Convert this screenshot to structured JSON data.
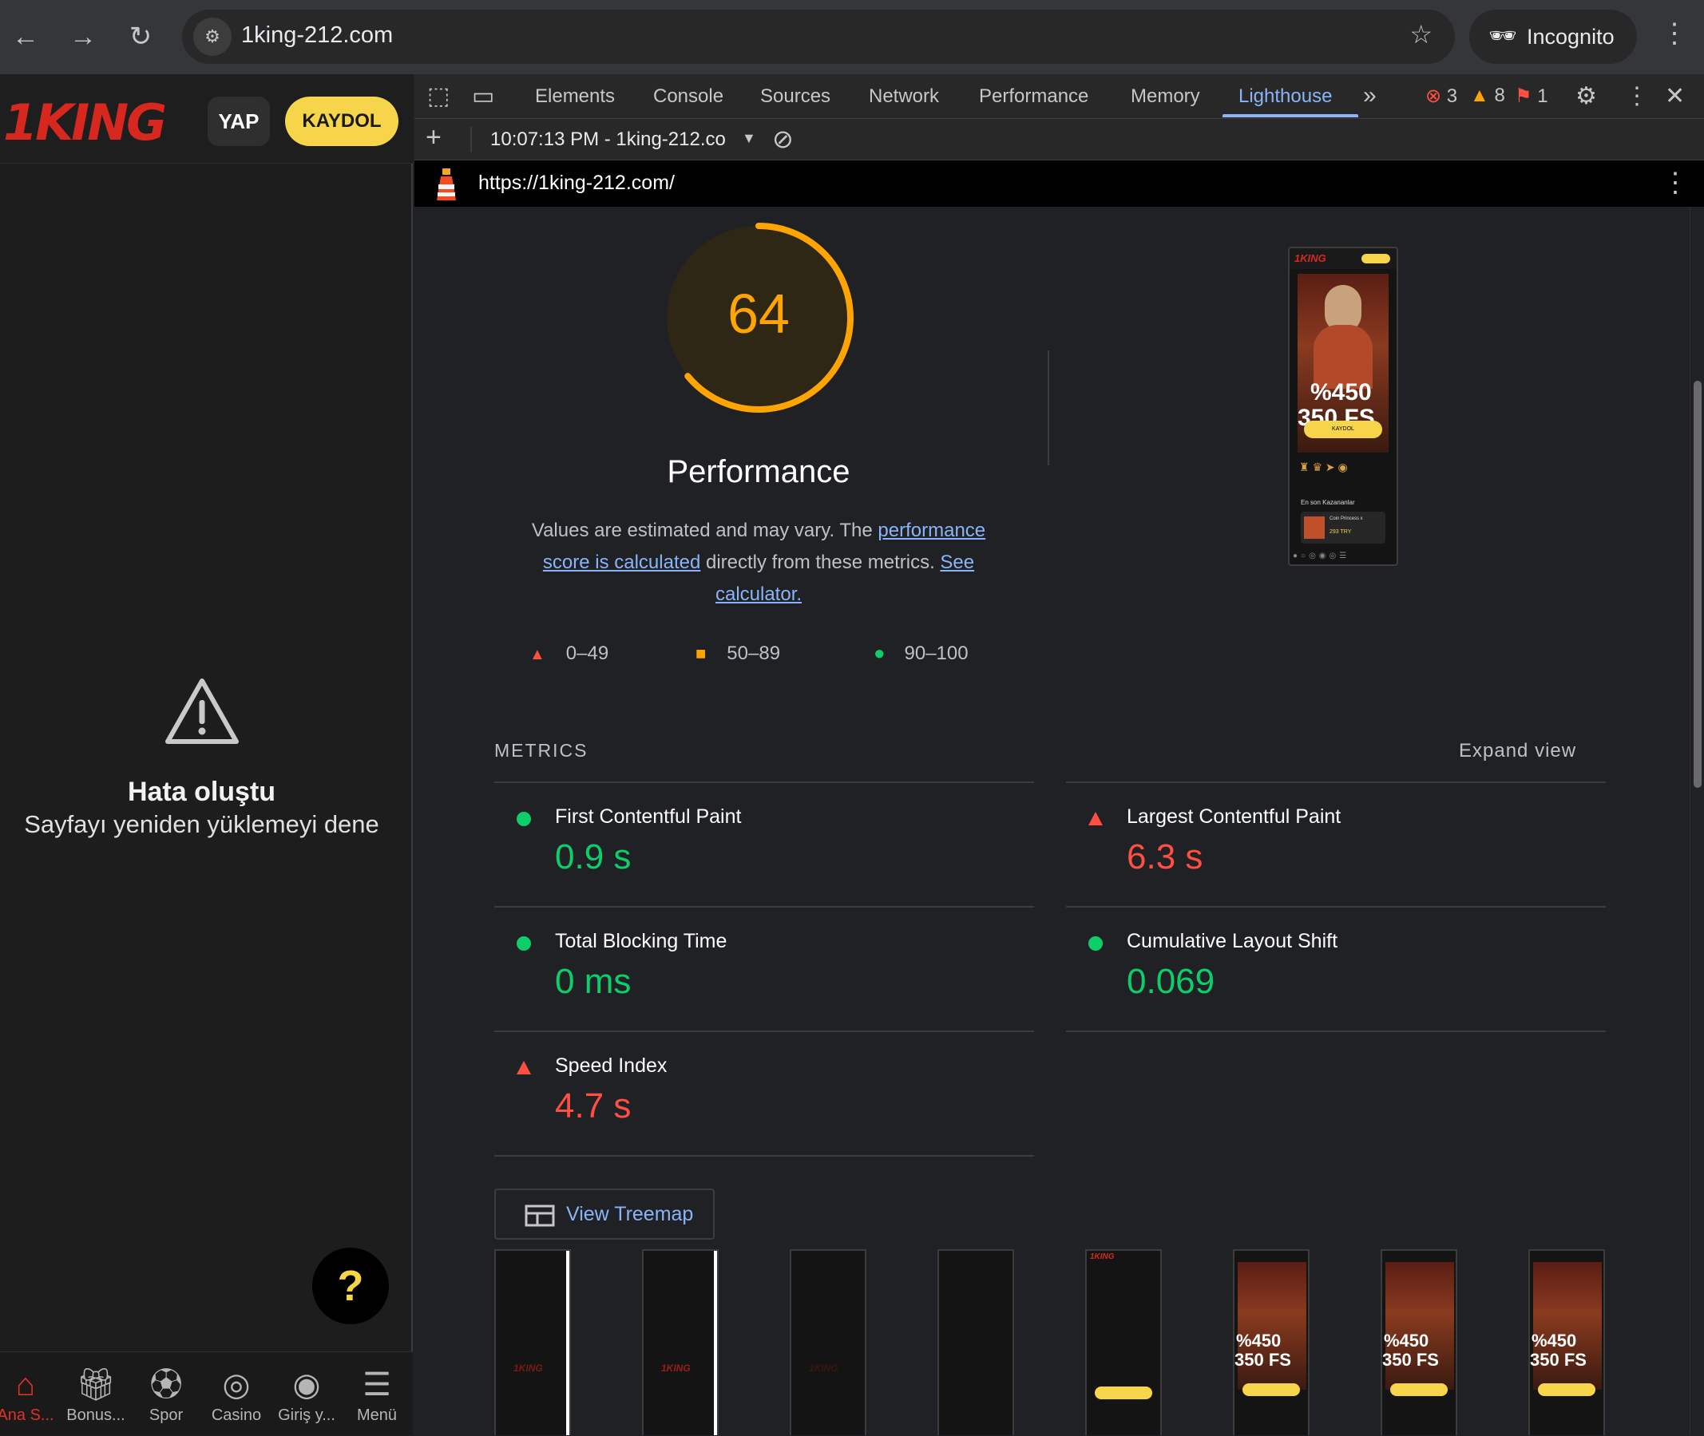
{
  "browser": {
    "url": "1king-212.com",
    "profile_label": "Incognito"
  },
  "site": {
    "logo_text": "1KING",
    "yap_label": "YAP",
    "kaydol_label": "KAYDOL",
    "error_title": "Hata oluştu",
    "error_subtitle": "Sayfayı yeniden yüklemeyi dene",
    "help_label": "?",
    "bottom_nav": [
      {
        "label": "Ana S...",
        "icon": "home-icon"
      },
      {
        "label": "Bonus...",
        "icon": "gift-icon"
      },
      {
        "label": "Spor",
        "icon": "football-icon"
      },
      {
        "label": "Casino",
        "icon": "roulette-icon"
      },
      {
        "label": "Giriş y...",
        "icon": "user-circle-icon"
      },
      {
        "label": "Menü",
        "icon": "hamburger-icon"
      }
    ]
  },
  "devtools": {
    "tabs": [
      "Elements",
      "Console",
      "Sources",
      "Network",
      "Performance",
      "Memory",
      "Lighthouse"
    ],
    "active_tab": "Lighthouse",
    "errors_count": "3",
    "warnings_count": "8",
    "issues_count": "1",
    "report_select": "10:07:13 PM - 1king-212.co",
    "report_url": "https://1king-212.com/"
  },
  "lighthouse": {
    "score": 64,
    "score_color": "#ffa400",
    "category": "Performance",
    "desc_before": "Values are estimated and may vary. The ",
    "desc_link1": "performance score is calculated",
    "desc_middle": " directly from these metrics. ",
    "desc_link2": "See calculator.",
    "legend": [
      {
        "range": "0–49",
        "shape": "triangle",
        "color": "#ff4e42"
      },
      {
        "range": "50–89",
        "shape": "square",
        "color": "#ffa400"
      },
      {
        "range": "90–100",
        "shape": "circle",
        "color": "#0cce6b"
      }
    ],
    "metrics_label": "METRICS",
    "expand_label": "Expand view",
    "metrics": [
      {
        "name": "First Contentful Paint",
        "value": "0.9 s",
        "status": "pass"
      },
      {
        "name": "Largest Contentful Paint",
        "value": "6.3 s",
        "status": "fail"
      },
      {
        "name": "Total Blocking Time",
        "value": "0 ms",
        "status": "pass"
      },
      {
        "name": "Cumulative Layout Shift",
        "value": "0.069",
        "status": "pass"
      },
      {
        "name": "Speed Index",
        "value": "4.7 s",
        "status": "fail"
      }
    ],
    "treemap_label": "View Treemap",
    "final_screenshot": {
      "promo_line1": "%450",
      "promo_line2": "350 FS",
      "cta": "KAYDOL",
      "section": "En son Kazananlar",
      "winner_game": "Coin Princess x",
      "winner_amount": "293 TRY"
    }
  }
}
